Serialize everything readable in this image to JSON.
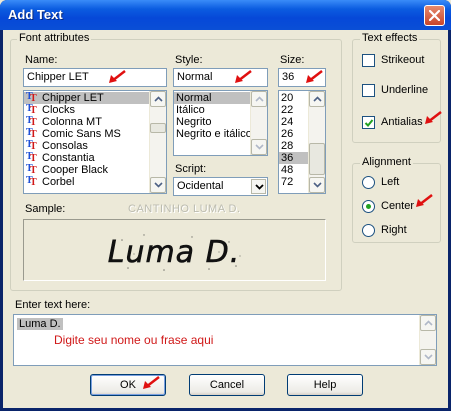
{
  "window": {
    "title": "Add Text"
  },
  "font_attributes": {
    "group_label": "Font attributes",
    "name_label": "Name:",
    "name_value": "Chipper LET",
    "fonts": [
      "Chipper LET",
      "Clocks",
      "Colonna MT",
      "Comic Sans MS",
      "Consolas",
      "Constantia",
      "Cooper Black",
      "Corbel"
    ],
    "style_label": "Style:",
    "style_value": "Normal",
    "styles": [
      "Normal",
      "Itálico",
      "Negrito",
      "Negrito e itálico"
    ],
    "size_label": "Size:",
    "size_value": "36",
    "sizes": [
      "20",
      "22",
      "24",
      "26",
      "28",
      "36",
      "48",
      "72"
    ],
    "script_label": "Script:",
    "script_value": "Ocidental",
    "sample_label": "Sample:",
    "sample_text": "Luma D.",
    "watermark": "CANTINHO LUMA D."
  },
  "text_effects": {
    "group_label": "Text effects",
    "strikeout": "Strikeout",
    "underline": "Underline",
    "antialias": "Antialias",
    "antialias_checked": true
  },
  "alignment": {
    "group_label": "Alignment",
    "left": "Left",
    "center": "Center",
    "right": "Right",
    "selected": "Center"
  },
  "enter_text": {
    "label": "Enter text here:",
    "value": "Luma D.",
    "hint": "Digite seu nome ou frase aqui"
  },
  "buttons": {
    "ok": "OK",
    "cancel": "Cancel",
    "help": "Help"
  },
  "colors": {
    "arrow": "#e01010",
    "hint": "#d01818",
    "titlebar": "#0648d8"
  }
}
